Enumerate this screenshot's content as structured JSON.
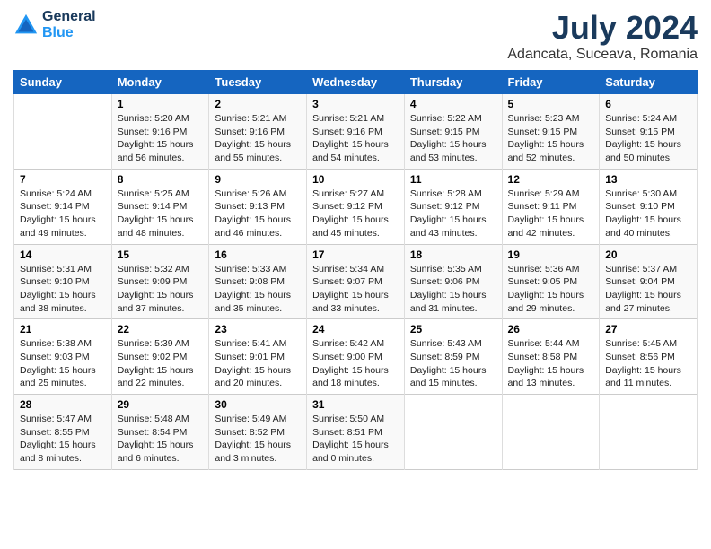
{
  "header": {
    "logo_line1": "General",
    "logo_line2": "Blue",
    "title": "July 2024",
    "subtitle": "Adancata, Suceava, Romania"
  },
  "weekdays": [
    "Sunday",
    "Monday",
    "Tuesday",
    "Wednesday",
    "Thursday",
    "Friday",
    "Saturday"
  ],
  "weeks": [
    [
      {
        "day": "",
        "info": ""
      },
      {
        "day": "1",
        "info": "Sunrise: 5:20 AM\nSunset: 9:16 PM\nDaylight: 15 hours\nand 56 minutes."
      },
      {
        "day": "2",
        "info": "Sunrise: 5:21 AM\nSunset: 9:16 PM\nDaylight: 15 hours\nand 55 minutes."
      },
      {
        "day": "3",
        "info": "Sunrise: 5:21 AM\nSunset: 9:16 PM\nDaylight: 15 hours\nand 54 minutes."
      },
      {
        "day": "4",
        "info": "Sunrise: 5:22 AM\nSunset: 9:15 PM\nDaylight: 15 hours\nand 53 minutes."
      },
      {
        "day": "5",
        "info": "Sunrise: 5:23 AM\nSunset: 9:15 PM\nDaylight: 15 hours\nand 52 minutes."
      },
      {
        "day": "6",
        "info": "Sunrise: 5:24 AM\nSunset: 9:15 PM\nDaylight: 15 hours\nand 50 minutes."
      }
    ],
    [
      {
        "day": "7",
        "info": "Sunrise: 5:24 AM\nSunset: 9:14 PM\nDaylight: 15 hours\nand 49 minutes."
      },
      {
        "day": "8",
        "info": "Sunrise: 5:25 AM\nSunset: 9:14 PM\nDaylight: 15 hours\nand 48 minutes."
      },
      {
        "day": "9",
        "info": "Sunrise: 5:26 AM\nSunset: 9:13 PM\nDaylight: 15 hours\nand 46 minutes."
      },
      {
        "day": "10",
        "info": "Sunrise: 5:27 AM\nSunset: 9:12 PM\nDaylight: 15 hours\nand 45 minutes."
      },
      {
        "day": "11",
        "info": "Sunrise: 5:28 AM\nSunset: 9:12 PM\nDaylight: 15 hours\nand 43 minutes."
      },
      {
        "day": "12",
        "info": "Sunrise: 5:29 AM\nSunset: 9:11 PM\nDaylight: 15 hours\nand 42 minutes."
      },
      {
        "day": "13",
        "info": "Sunrise: 5:30 AM\nSunset: 9:10 PM\nDaylight: 15 hours\nand 40 minutes."
      }
    ],
    [
      {
        "day": "14",
        "info": "Sunrise: 5:31 AM\nSunset: 9:10 PM\nDaylight: 15 hours\nand 38 minutes."
      },
      {
        "day": "15",
        "info": "Sunrise: 5:32 AM\nSunset: 9:09 PM\nDaylight: 15 hours\nand 37 minutes."
      },
      {
        "day": "16",
        "info": "Sunrise: 5:33 AM\nSunset: 9:08 PM\nDaylight: 15 hours\nand 35 minutes."
      },
      {
        "day": "17",
        "info": "Sunrise: 5:34 AM\nSunset: 9:07 PM\nDaylight: 15 hours\nand 33 minutes."
      },
      {
        "day": "18",
        "info": "Sunrise: 5:35 AM\nSunset: 9:06 PM\nDaylight: 15 hours\nand 31 minutes."
      },
      {
        "day": "19",
        "info": "Sunrise: 5:36 AM\nSunset: 9:05 PM\nDaylight: 15 hours\nand 29 minutes."
      },
      {
        "day": "20",
        "info": "Sunrise: 5:37 AM\nSunset: 9:04 PM\nDaylight: 15 hours\nand 27 minutes."
      }
    ],
    [
      {
        "day": "21",
        "info": "Sunrise: 5:38 AM\nSunset: 9:03 PM\nDaylight: 15 hours\nand 25 minutes."
      },
      {
        "day": "22",
        "info": "Sunrise: 5:39 AM\nSunset: 9:02 PM\nDaylight: 15 hours\nand 22 minutes."
      },
      {
        "day": "23",
        "info": "Sunrise: 5:41 AM\nSunset: 9:01 PM\nDaylight: 15 hours\nand 20 minutes."
      },
      {
        "day": "24",
        "info": "Sunrise: 5:42 AM\nSunset: 9:00 PM\nDaylight: 15 hours\nand 18 minutes."
      },
      {
        "day": "25",
        "info": "Sunrise: 5:43 AM\nSunset: 8:59 PM\nDaylight: 15 hours\nand 15 minutes."
      },
      {
        "day": "26",
        "info": "Sunrise: 5:44 AM\nSunset: 8:58 PM\nDaylight: 15 hours\nand 13 minutes."
      },
      {
        "day": "27",
        "info": "Sunrise: 5:45 AM\nSunset: 8:56 PM\nDaylight: 15 hours\nand 11 minutes."
      }
    ],
    [
      {
        "day": "28",
        "info": "Sunrise: 5:47 AM\nSunset: 8:55 PM\nDaylight: 15 hours\nand 8 minutes."
      },
      {
        "day": "29",
        "info": "Sunrise: 5:48 AM\nSunset: 8:54 PM\nDaylight: 15 hours\nand 6 minutes."
      },
      {
        "day": "30",
        "info": "Sunrise: 5:49 AM\nSunset: 8:52 PM\nDaylight: 15 hours\nand 3 minutes."
      },
      {
        "day": "31",
        "info": "Sunrise: 5:50 AM\nSunset: 8:51 PM\nDaylight: 15 hours\nand 0 minutes."
      },
      {
        "day": "",
        "info": ""
      },
      {
        "day": "",
        "info": ""
      },
      {
        "day": "",
        "info": ""
      }
    ]
  ]
}
